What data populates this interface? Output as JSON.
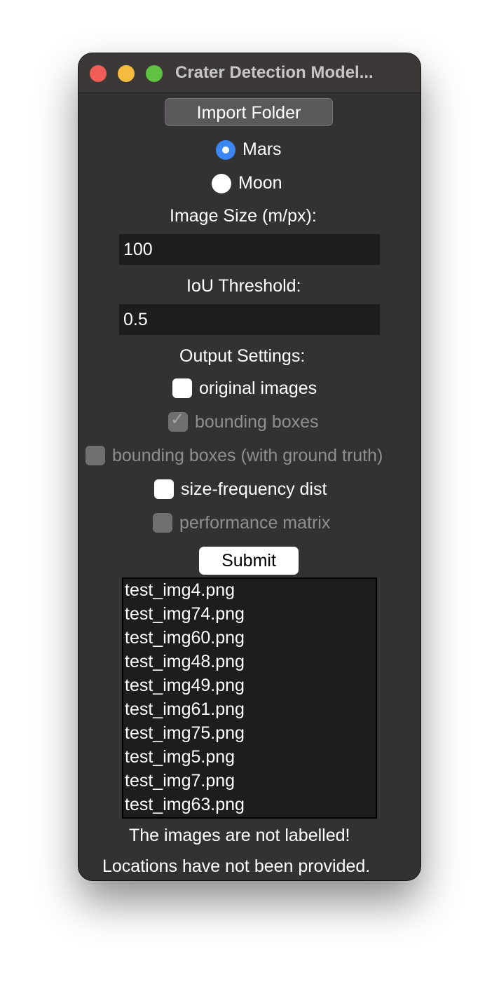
{
  "window": {
    "title": "Crater Detection Model..."
  },
  "import_button": "Import Folder",
  "planets": [
    {
      "label": "Mars",
      "selected": true
    },
    {
      "label": "Moon",
      "selected": false
    }
  ],
  "image_size": {
    "label": "Image Size (m/px):",
    "value": "100"
  },
  "iou": {
    "label": "IoU Threshold:",
    "value": "0.5"
  },
  "output": {
    "heading": "Output Settings:",
    "options": [
      {
        "label": "original images",
        "checked": false,
        "enabled": true
      },
      {
        "label": "bounding boxes",
        "checked": true,
        "enabled": false
      },
      {
        "label": "bounding boxes (with ground truth)",
        "checked": false,
        "enabled": false
      },
      {
        "label": "size-frequency dist",
        "checked": false,
        "enabled": true
      },
      {
        "label": "performance matrix",
        "checked": false,
        "enabled": false
      }
    ]
  },
  "submit_button": "Submit",
  "files": [
    "test_img4.png",
    "test_img74.png",
    "test_img60.png",
    "test_img48.png",
    "test_img49.png",
    "test_img61.png",
    "test_img75.png",
    "test_img5.png",
    "test_img7.png",
    "test_img63.png"
  ],
  "messages": [
    "The images are not labelled!",
    "Locations have not been provided."
  ],
  "colors": {
    "window_bg": "#323232",
    "radio_accent": "#3a86f5",
    "close": "#ee5e56",
    "minimize": "#f4bb3e",
    "maximize": "#5fc243"
  }
}
